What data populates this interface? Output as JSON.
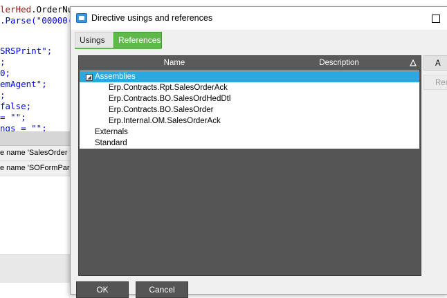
{
  "editor": {
    "lines": [
      {
        "parts": [
          {
            "t": "lerHed",
            "c": "red"
          },
          {
            "t": ".OrderNu",
            "c": "dark"
          }
        ]
      },
      {
        "parts": [
          {
            "t": ".Parse(\"00000(",
            "c": "blue"
          }
        ]
      },
      {
        "parts": [
          {
            "t": "SRSPrint\";",
            "c": "blue"
          }
        ]
      },
      {
        "parts": [
          {
            "t": ";",
            "c": "blue"
          }
        ]
      },
      {
        "parts": [
          {
            "t": "0;",
            "c": "blue"
          }
        ]
      },
      {
        "parts": [
          {
            "t": "emAgent\";",
            "c": "blue"
          }
        ]
      },
      {
        "parts": [
          {
            "t": ";",
            "c": "blue"
          }
        ]
      },
      {
        "parts": [
          {
            "t": "false;",
            "c": "blue"
          }
        ]
      },
      {
        "parts": [
          {
            "t": "= \"\";",
            "c": "blue"
          }
        ]
      },
      {
        "parts": [
          {
            "t": "ngs = \"\";",
            "c": "blue"
          }
        ]
      }
    ],
    "error_rows": [
      "e name 'SalesOrder",
      "e name 'SOFormPar"
    ]
  },
  "dialog": {
    "title": "Directive usings and references",
    "tabs": [
      {
        "label": "Usings",
        "active": false
      },
      {
        "label": "References",
        "active": true
      }
    ],
    "grid": {
      "columns": [
        "Name",
        "Description"
      ],
      "rows": [
        {
          "label": "Assemblies",
          "level": 0,
          "selected": true,
          "expanded": true
        },
        {
          "label": "Erp.Contracts.Rpt.SalesOrderAck",
          "level": 1
        },
        {
          "label": "Erp.Contracts.BO.SalesOrdHedDtl",
          "level": 1
        },
        {
          "label": "Erp.Contracts.BO.SalesOrder",
          "level": 1
        },
        {
          "label": "Erp.Internal.OM.SalesOrderAck",
          "level": 1
        },
        {
          "label": "Externals",
          "level": 0
        },
        {
          "label": "Standard",
          "level": 0
        }
      ]
    },
    "side_buttons": {
      "add": "A",
      "remove": "Rem"
    },
    "ok_label": "OK",
    "cancel_label": "Cancel"
  },
  "colors": {
    "accent_tab": "#5fb84a",
    "selection": "#2aa8e0",
    "grid_background": "#555555"
  }
}
